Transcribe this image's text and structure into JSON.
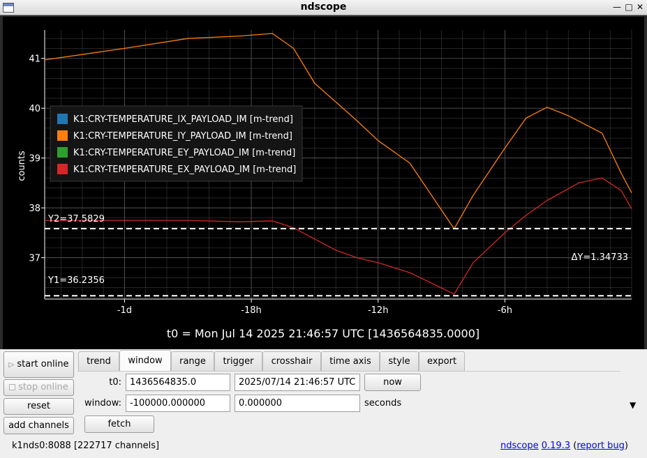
{
  "window": {
    "title": "ndscope"
  },
  "plot": {
    "ylabel": "counts",
    "t0_label": "t0 = Mon Jul 14 2025 21:46:57 UTC [1436564835.0000]",
    "cursor_y2_label": "Y2=37.5829",
    "cursor_y1_label": "Y1=36.2356",
    "delta_label": "ΔY=1.34733",
    "colors": {
      "background": "#000000",
      "axis": "#ffffff",
      "grid": "#3c3c3c",
      "cursor": "#ffffff"
    }
  },
  "chart_data": {
    "type": "line",
    "xlabel": "",
    "ylabel": "counts",
    "x_units": "hours relative to t0",
    "xlim": [
      -27.78,
      0
    ],
    "ylim": [
      36.17,
      41.57
    ],
    "x_ticks": [
      {
        "value": -24,
        "label": "-1d"
      },
      {
        "value": -18,
        "label": "-18h"
      },
      {
        "value": -12,
        "label": "-12h"
      },
      {
        "value": -6,
        "label": "-6h"
      }
    ],
    "y_ticks": [
      {
        "value": 37,
        "label": "37"
      },
      {
        "value": 38,
        "label": "38"
      },
      {
        "value": 39,
        "label": "39"
      },
      {
        "value": 40,
        "label": "40"
      },
      {
        "value": 41,
        "label": "41"
      }
    ],
    "grid": true,
    "legend_position": "top-left",
    "series": [
      {
        "name": "K1:CRY-TEMPERATURE_IX_PAYLOAD_IM [m-trend]",
        "color": "#1f77b4",
        "x": [],
        "y": []
      },
      {
        "name": "K1:CRY-TEMPERATURE_IY_PAYLOAD_IM [m-trend]",
        "color": "#ff7f0e",
        "x": [
          -27.78,
          -24,
          -21,
          -18.5,
          -17,
          -16,
          -15,
          -13,
          -12,
          -10.5,
          -8.4,
          -7.5,
          -6,
          -5,
          -4,
          -3,
          -1.4,
          -0.5,
          0
        ],
        "y": [
          40.97,
          41.2,
          41.4,
          41.45,
          41.5,
          41.2,
          40.5,
          39.75,
          39.35,
          38.9,
          37.58,
          38.25,
          39.2,
          39.8,
          40.02,
          39.85,
          39.5,
          38.7,
          38.3
        ]
      },
      {
        "name": "K1:CRY-TEMPERATURE_EY_PAYLOAD_IM [m-trend]",
        "color": "#2ca02c",
        "x": [],
        "y": []
      },
      {
        "name": "K1:CRY-TEMPERATURE_EX_PAYLOAD_IM [m-trend]",
        "color": "#d62728",
        "x": [
          -27.78,
          -24,
          -21,
          -18.5,
          -17,
          -16,
          -14,
          -13,
          -12,
          -10.5,
          -8.4,
          -7.5,
          -6,
          -5,
          -4,
          -2.5,
          -1.4,
          -0.5,
          0
        ],
        "y": [
          37.75,
          37.75,
          37.75,
          37.72,
          37.74,
          37.6,
          37.15,
          37.0,
          36.9,
          36.7,
          36.27,
          36.9,
          37.5,
          37.85,
          38.15,
          38.5,
          38.6,
          38.35,
          37.98
        ]
      }
    ],
    "cursors": {
      "y1": 36.2356,
      "y2": 37.5829
    }
  },
  "sidebar": {
    "start_online": "start online",
    "stop_online": "stop online",
    "reset": "reset",
    "add_channels": "add channels"
  },
  "tabs": [
    {
      "label": "trend",
      "active": false
    },
    {
      "label": "window",
      "active": true
    },
    {
      "label": "range",
      "active": false
    },
    {
      "label": "trigger",
      "active": false
    },
    {
      "label": "crosshair",
      "active": false
    },
    {
      "label": "time axis",
      "active": false
    },
    {
      "label": "style",
      "active": false
    },
    {
      "label": "export",
      "active": false
    }
  ],
  "window_panel": {
    "t0_label": "t0:",
    "t0_gps": "1436564835.0",
    "t0_utc": "2025/07/14 21:46:57 UTC",
    "now_button": "now",
    "window_label": "window:",
    "window_start": "-100000.000000",
    "window_end": "0.000000",
    "units": "seconds",
    "fetch_button": "fetch"
  },
  "status": {
    "server": "k1nds0:8088",
    "channels": "[222717 channels]"
  },
  "about": {
    "name": "ndscope",
    "version": "0.19.3",
    "report": "report bug",
    "open_paren": "(",
    "close_paren": ")"
  }
}
